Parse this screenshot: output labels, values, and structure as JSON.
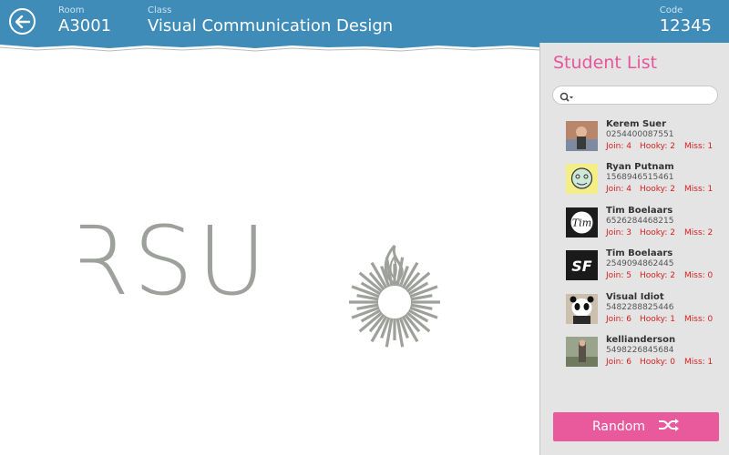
{
  "header": {
    "room_label": "Room",
    "room_value": "A3001",
    "class_label": "Class",
    "class_value": "Visual Communication Design",
    "code_label": "Code",
    "code_value": "12345"
  },
  "logo": {
    "text": "RSU"
  },
  "panel": {
    "title": "Student List",
    "search_placeholder": "",
    "random_label": "Random"
  },
  "students": [
    {
      "name": "Kerem Suer",
      "code": "0254400087551",
      "join": "Join: 4",
      "hooky": "Hooky: 2",
      "miss": "Miss: 1"
    },
    {
      "name": "Ryan Putnam",
      "code": "1568946515461",
      "join": "Join: 4",
      "hooky": "Hooky: 2",
      "miss": "Miss: 1"
    },
    {
      "name": "Tim Boelaars",
      "code": "6526284468215",
      "join": "Join: 3",
      "hooky": "Hooky: 2",
      "miss": "Miss: 2"
    },
    {
      "name": "Tim Boelaars",
      "code": "2549094862445",
      "join": "Join: 5",
      "hooky": "Hooky: 2",
      "miss": "Miss: 0"
    },
    {
      "name": "Visual Idiot",
      "code": "5482288825446",
      "join": "Join: 6",
      "hooky": "Hooky: 1",
      "miss": "Miss: 0"
    },
    {
      "name": "kellianderson",
      "code": "5498226845684",
      "join": "Join: 6",
      "hooky": "Hooky: 0",
      "miss": "Miss: 1"
    }
  ],
  "colors": {
    "header": "#3f8cb8",
    "accent": "#e8559a",
    "stat": "#d32020"
  }
}
